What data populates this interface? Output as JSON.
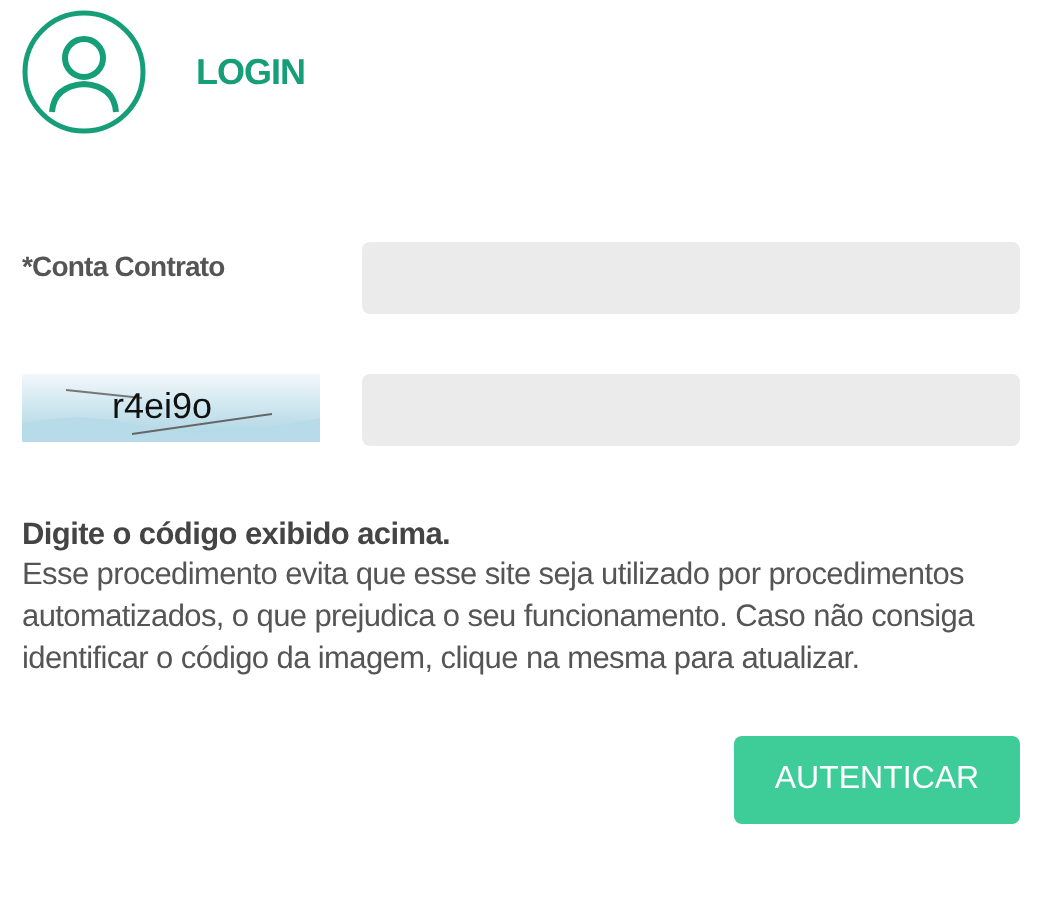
{
  "header": {
    "title": "LOGIN"
  },
  "form": {
    "account_label": "*Conta Contrato",
    "captcha_code": "r4ei9o"
  },
  "instructions": {
    "heading": "Digite o código exibido acima.",
    "body": "Esse procedimento evita que esse site seja utilizado por procedimentos automatizados, o que prejudica o seu funcionamento. Caso não consiga identificar o código da imagem, clique na mesma para atualizar."
  },
  "buttons": [
    "AUTENTICAR"
  ]
}
